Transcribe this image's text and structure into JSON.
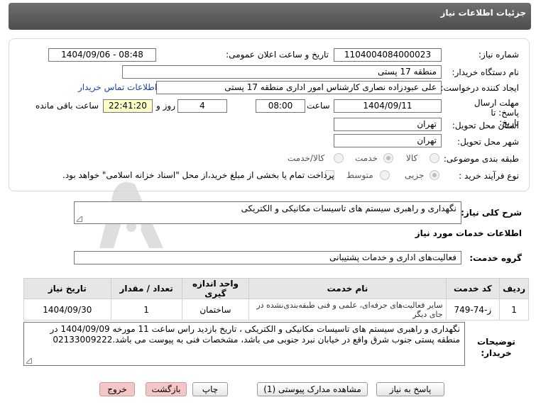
{
  "header": {
    "title": "جزئیات اطلاعات نیاز"
  },
  "form": {
    "need_number_label": "شماره نیاز:",
    "need_number": "1104004084000023",
    "announce_label": "تاریخ و ساعت اعلان عمومی:",
    "announce_value": "1404/09/06 - 08:48",
    "buyer_label": "نام دستگاه خریدار:",
    "buyer_value": "منطقه 17 پستی",
    "creator_label": "ایجاد کننده درخواست:",
    "creator_value": "علی عبودزاده نصاری کارشناس امور اداری منطقه 17 پستی",
    "contact_link": "اطلاعات تماس خریدار",
    "deadline_label": "مهلت ارسال پاسخ: تا تاریخ:",
    "deadline_date": "1404/09/11",
    "time_label": "ساعت",
    "deadline_time": "08:00",
    "days_value": "4",
    "days_label": "روز و",
    "remaining_time": "22:41:20",
    "remaining_label": "ساعت باقی مانده",
    "province_label": "استان محل تحویل:",
    "province_value": "تهران",
    "city_label": "شهر محل تحویل:",
    "city_value": "تهران",
    "category_label": "طبقه بندی موضوعی:",
    "category_options": [
      "کالا",
      "خدمت",
      "کالا/خدمت"
    ],
    "purchase_label": "نوع فرآیند خرید :",
    "purchase_options": [
      "جزیی",
      "متوسط"
    ],
    "payment_note": "پرداخت تمام یا بخشی از مبلغ خرید،از محل \"اسناد خزانه اسلامی\" خواهد بود."
  },
  "summary": {
    "label": "شرح کلی نیاز:",
    "value": "نگهداری و راهبری سیستم های تاسیسات مکانیکی و الکتریکی"
  },
  "services": {
    "section_title": "اطلاعات خدمات مورد نیاز",
    "group_label": "گروه خدمت:",
    "group_value": "فعالیت‌های اداری و خدمات پشتیبانی",
    "columns": [
      "ردیف",
      "کد خدمت",
      "نام خدمت",
      "واحد اندازه گیری",
      "تعداد / مقدار",
      "تاریخ نیاز"
    ],
    "rows": [
      {
        "index": "1",
        "code": "ز-74-749",
        "name": "سایر فعالیت‌های حرفه‌ای، علمی و فنی طبقه‌بندی‌نشده در جای دیگر",
        "unit": "ساختمان",
        "qty": "1",
        "date": "1404/09/30"
      }
    ]
  },
  "buyer_notes": {
    "label": "توضیحات خریدار:",
    "text": "نگهداری و راهبری سیستم های تاسیسات مکانیکی و الکتریکی ، تاریخ بازدید راس ساعت 11 مورخه 1404/09/09  در منطقه پستی جنوب شرق واقع در خیابان نبرد جنوبی می باشد، مشخصات فنی به پیوست می باشد.02133009222"
  },
  "buttons": {
    "reply": "پاسخ به نیاز",
    "view_docs": "مشاهده مدارک پیوستی (1)",
    "print": "چاپ",
    "back": "بازگشت",
    "exit": "خروج"
  },
  "colors": {
    "header_bg": "#5c5c5c",
    "link": "#1a3fb3",
    "remaining_bg": "#ffffc8",
    "exit_btn": "#f4c6c6",
    "watermark": "#d9d9d9"
  }
}
